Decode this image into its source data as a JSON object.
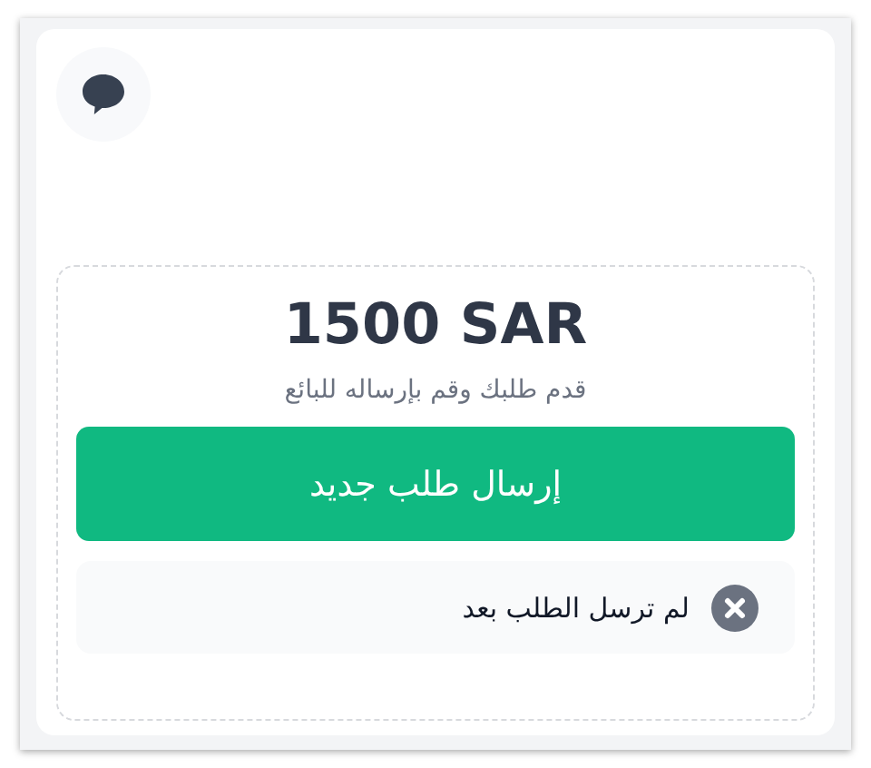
{
  "amount": "1500 SAR",
  "subtitle": "قدم طلبك وقم بإرساله للبائع",
  "submit_button": {
    "label": "إرسال طلب جديد"
  },
  "status": {
    "text": "لم ترسل الطلب بعد",
    "sent": false
  }
}
